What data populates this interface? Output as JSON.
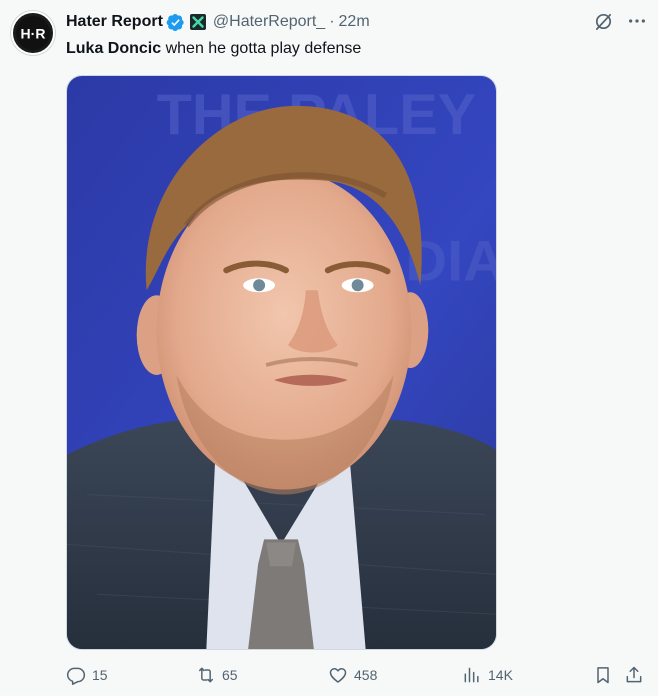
{
  "author": {
    "name": "Hater Report",
    "handle": "@HaterReport_",
    "separator": "·",
    "time": "22m",
    "avatar_text": "H·R"
  },
  "post": {
    "bold": "Luka Doncic",
    "text": " when he gotta play defense"
  },
  "media": {
    "backdrop_text_1": "THE PALEY",
    "backdrop_text_2": "DIA"
  },
  "metrics": {
    "replies": "15",
    "reposts": "65",
    "likes": "458",
    "views": "14K"
  },
  "colors": {
    "text": "#0f1419",
    "muted": "#536471",
    "verified": "#1d9bf0",
    "background": "#f7f9f9",
    "media_backdrop": "#2f3fb0"
  },
  "icons": {
    "verified": "verified-badge-icon",
    "affiliate": "x-affiliate-icon",
    "grok": "grok-icon",
    "more": "more-icon",
    "reply": "reply-icon",
    "repost": "repost-icon",
    "like": "like-icon",
    "views": "views-icon",
    "bookmark": "bookmark-icon",
    "share": "share-icon"
  }
}
